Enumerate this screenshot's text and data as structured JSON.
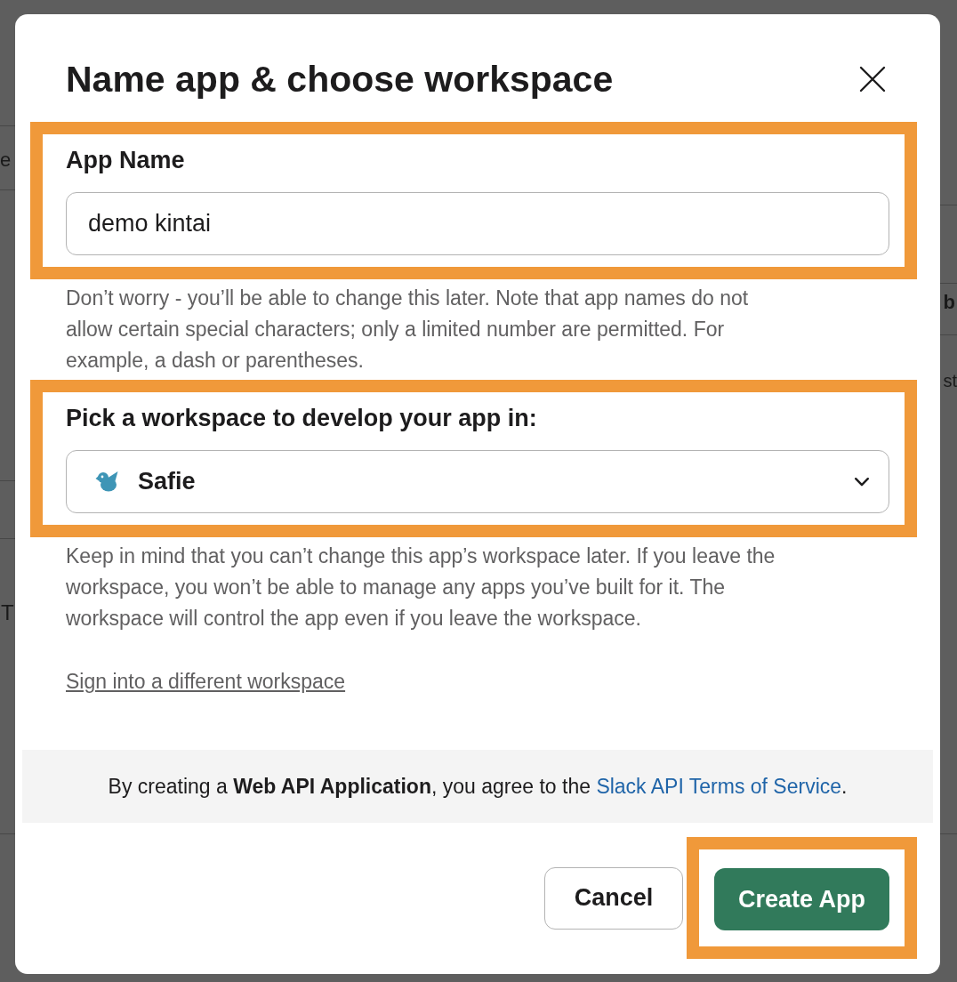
{
  "background_page": {
    "fragments": [
      "e",
      "b",
      "st",
      "T"
    ]
  },
  "dialog": {
    "title": "Name app & choose workspace"
  },
  "app_name": {
    "label": "App Name",
    "value": "demo kintai",
    "highlighted": true,
    "help": "Don’t worry - you’ll be able to change this later. Note that app names do not allow certain special characters; only a limited number are permitted. For example, a dash or parentheses."
  },
  "workspace": {
    "label": "Pick a workspace to develop your app in:",
    "value": "Safie",
    "highlighted": true,
    "help": "Keep in mind that you can’t change this app’s workspace later. If you leave the workspace, you won’t be able to manage any apps you’ve built for it. The workspace will control the app even if you leave the workspace."
  },
  "sign_in_link": "Sign into a different workspace",
  "notice": {
    "before": "By creating a **Web API Application**, you agree to the",
    "link": "Slack API Terms of Service",
    "after": "."
  },
  "buttons": [
    {
      "label": "Cancel",
      "kind": "secondary",
      "highlighted": false
    },
    {
      "label": "Create App",
      "kind": "primary",
      "highlighted": true
    }
  ]
}
